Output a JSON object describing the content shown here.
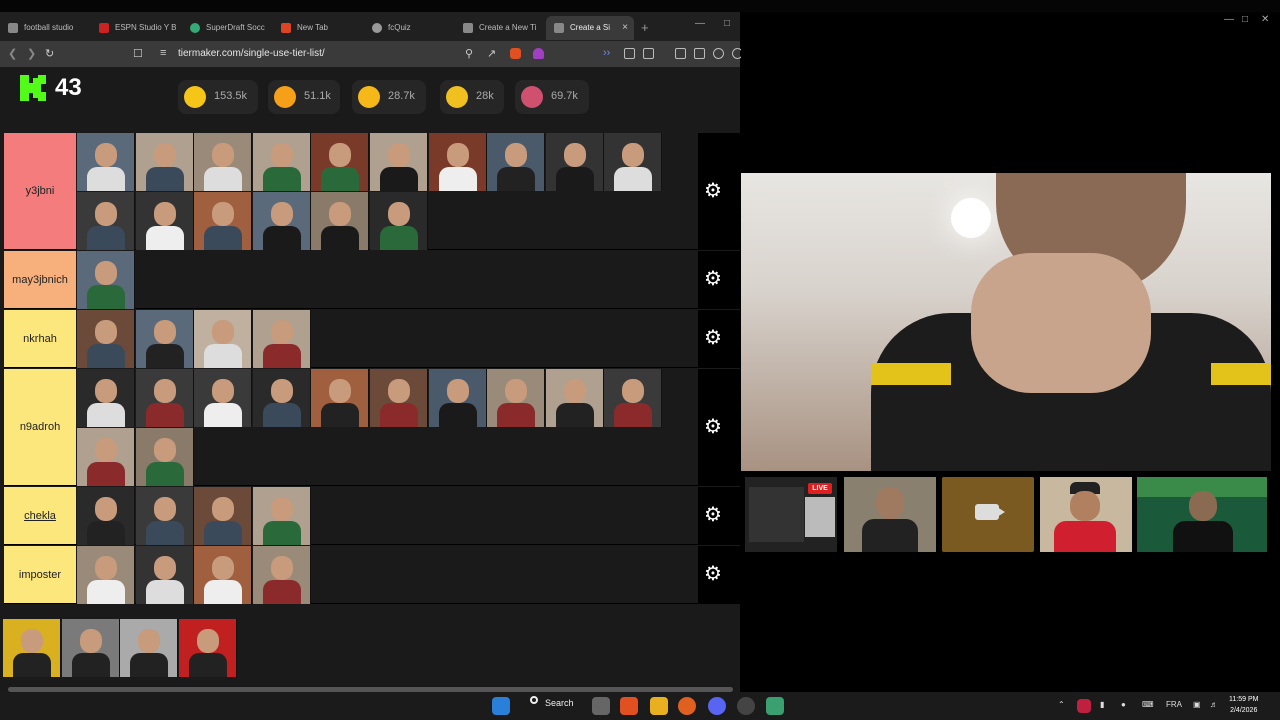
{
  "browser": {
    "tabs": [
      {
        "label": "football studio",
        "color": "#888888"
      },
      {
        "label": "ESPN Studio Y B",
        "color": "#cc2222"
      },
      {
        "label": "SuperDraft Socc",
        "color": "#33aa77"
      },
      {
        "label": "New Tab",
        "color": "#dd4422"
      },
      {
        "label": "fcQuiz",
        "color": "#999999"
      },
      {
        "label": "Create a New Ti",
        "color": "#888888"
      },
      {
        "label": "Create a Si",
        "color": "#888888"
      }
    ],
    "active_tab_close": "×",
    "new_tab": "+",
    "url": "tiermaker.com/single-use-tier-list/"
  },
  "stream": {
    "viewers": "43",
    "reactions": [
      {
        "icon": "grinning-face-icon",
        "count": "153.5k",
        "color": "#f5c518"
      },
      {
        "icon": "heart-eyes-icon",
        "count": "51.1k",
        "color": "#f5a018"
      },
      {
        "icon": "laughing-face-icon",
        "count": "28.7k",
        "color": "#f5b818"
      },
      {
        "icon": "raised-hands-icon",
        "count": "28k",
        "color": "#f0c020"
      },
      {
        "icon": "poop-icon",
        "count": "69.7k",
        "color": "#d05070"
      }
    ]
  },
  "tiers": [
    {
      "label": "y3jbni",
      "color": "#f47c7c",
      "count": 16
    },
    {
      "label": "may3jbnich",
      "color": "#f7b07c",
      "count": 1
    },
    {
      "label": "nkrhah",
      "color": "#fbe77c",
      "count": 4
    },
    {
      "label": "n9adroh",
      "color": "#fbe77c",
      "count": 12
    },
    {
      "label": "chekla",
      "color": "#fbe77c",
      "count": 4
    },
    {
      "label": "imposter",
      "color": "#fbe77c",
      "count": 4
    }
  ],
  "pool_count": 4,
  "call": {
    "live_badge": "LIVE"
  },
  "taskbar": {
    "search_label": "Search",
    "language": "FRA",
    "time": "11:59 PM",
    "date": "2/4/2026"
  }
}
